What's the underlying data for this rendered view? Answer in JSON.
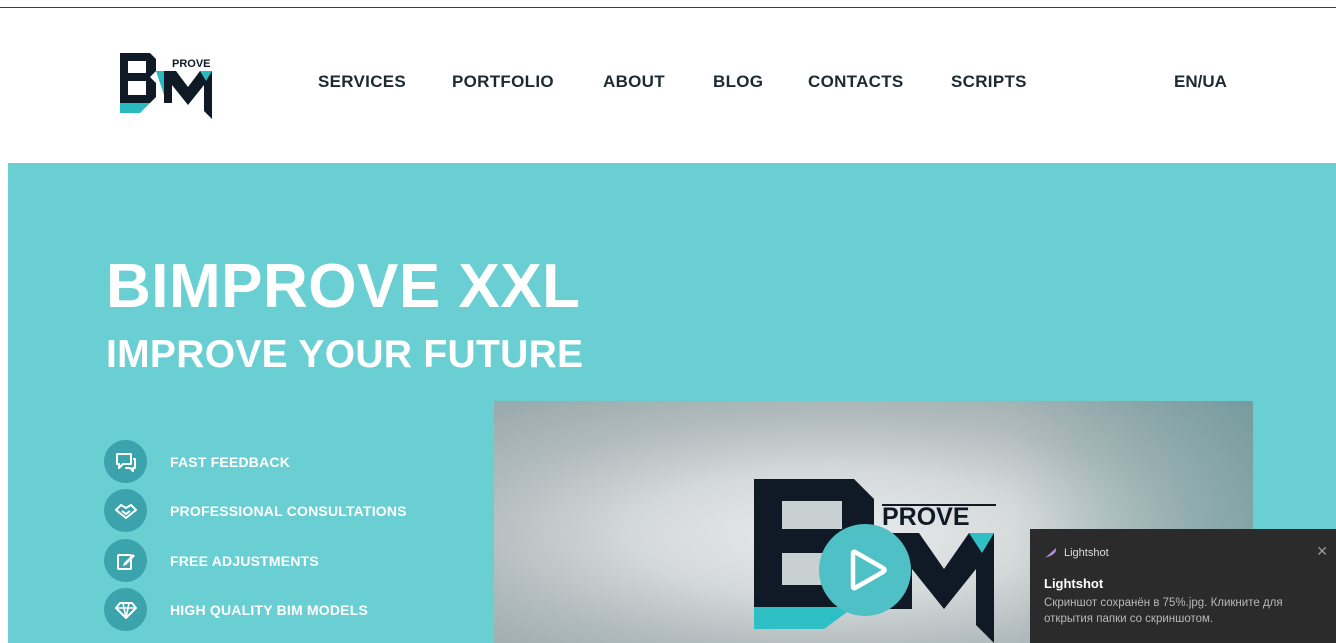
{
  "brand": {
    "logo_word": "PROVE"
  },
  "nav": {
    "items": [
      {
        "label": "SERVICES"
      },
      {
        "label": "PORTFOLIO"
      },
      {
        "label": "ABOUT"
      },
      {
        "label": "BLOG"
      },
      {
        "label": "CONTACTS"
      },
      {
        "label": "SCRIPTS"
      }
    ],
    "language": "EN/UA"
  },
  "hero": {
    "title": "BIMPROVE XXL",
    "subtitle": "IMPROVE YOUR FUTURE",
    "features": [
      {
        "label": "FAST FEEDBACK",
        "icon": "chat-icon"
      },
      {
        "label": "PROFESSIONAL CONSULTATIONS",
        "icon": "handshake-icon"
      },
      {
        "label": "FREE ADJUSTMENTS",
        "icon": "edit-icon"
      },
      {
        "label": "HIGH QUALITY BIM MODELS",
        "icon": "diamond-icon"
      }
    ]
  },
  "video": {
    "logo_word": "PROVE"
  },
  "toast": {
    "app_name": "Lightshot",
    "title": "Lightshot",
    "body": "Скриншот сохранён в 75%.jpg. Кликните для открытия папки со скриншотом.",
    "close": "✕"
  },
  "colors": {
    "hero_bg": "#6acfd3",
    "nav_text": "#1e2a30",
    "accent": "#3aa3ab",
    "toast_bg": "#2b2b2b"
  }
}
